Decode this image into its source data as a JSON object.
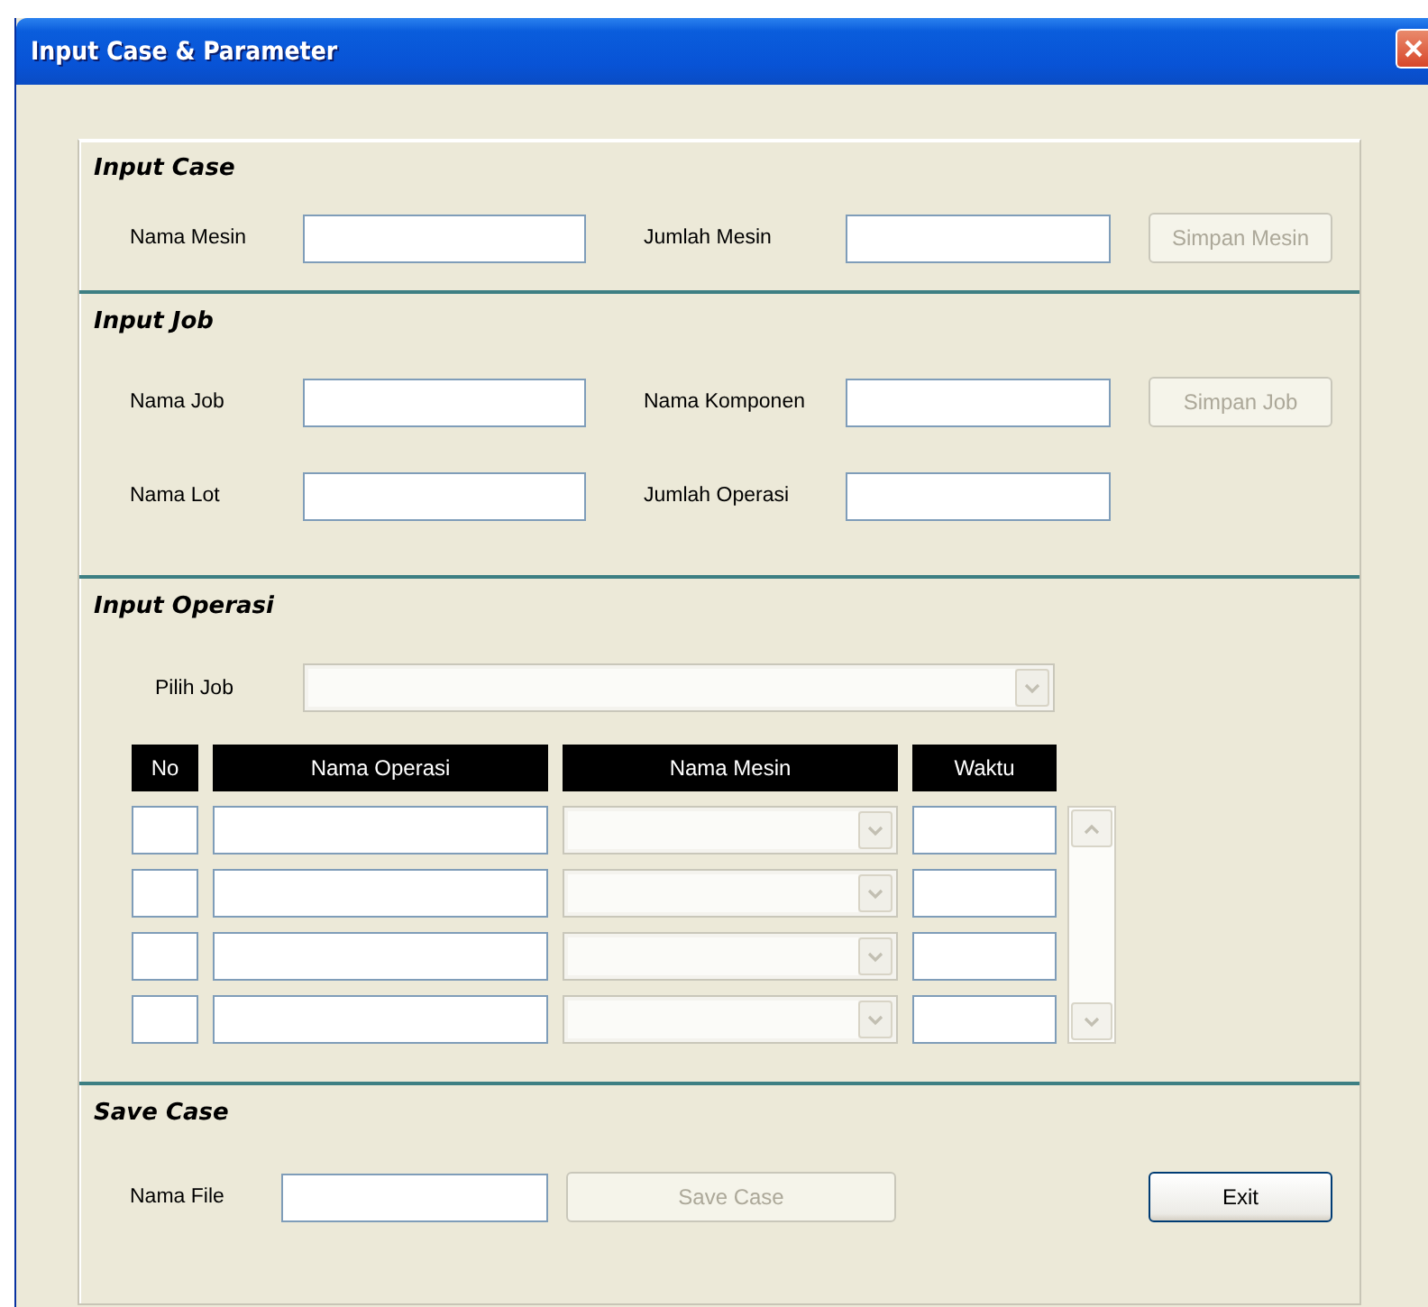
{
  "window": {
    "title": "Input Case & Parameter"
  },
  "sections": [
    {
      "kind": "form",
      "title": "Input Case",
      "rows": [
        {
          "items": [
            {
              "kind": "label",
              "text": "Nama Mesin"
            },
            {
              "kind": "field"
            },
            {
              "kind": "label",
              "text": "Jumlah Mesin"
            },
            {
              "kind": "field"
            },
            {
              "kind": "button",
              "label": "Simpan Mesin",
              "disabled": true
            }
          ]
        }
      ]
    },
    {
      "kind": "form",
      "title": "Input Job",
      "rows": [
        {
          "items": [
            {
              "kind": "label",
              "text": "Nama Job"
            },
            {
              "kind": "field"
            },
            {
              "kind": "label",
              "text": "Nama Komponen"
            },
            {
              "kind": "field"
            },
            {
              "kind": "button",
              "label": "Simpan Job",
              "disabled": true
            }
          ]
        },
        {
          "items": [
            {
              "kind": "label",
              "text": "Nama Lot"
            },
            {
              "kind": "field"
            },
            {
              "kind": "label",
              "text": "Jumlah Operasi"
            },
            {
              "kind": "field"
            }
          ]
        }
      ]
    },
    {
      "kind": "table",
      "title": "Input Operasi",
      "selector": {
        "label": "Pilih Job",
        "disabled": true
      },
      "columns": [
        "No",
        "Nama Operasi",
        "Nama Mesin",
        "Waktu"
      ],
      "rows": [
        {
          "cells": [
            {
              "kind": "field"
            },
            {
              "kind": "field"
            },
            {
              "kind": "combo",
              "disabled": true
            },
            {
              "kind": "field"
            }
          ]
        },
        {
          "cells": [
            {
              "kind": "field"
            },
            {
              "kind": "field"
            },
            {
              "kind": "combo",
              "disabled": true
            },
            {
              "kind": "field"
            }
          ]
        },
        {
          "cells": [
            {
              "kind": "field"
            },
            {
              "kind": "field"
            },
            {
              "kind": "combo",
              "disabled": true
            },
            {
              "kind": "field"
            }
          ]
        },
        {
          "cells": [
            {
              "kind": "field"
            },
            {
              "kind": "field"
            },
            {
              "kind": "combo",
              "disabled": true
            },
            {
              "kind": "field"
            }
          ]
        }
      ]
    },
    {
      "kind": "save",
      "title": "Save Case",
      "rows": [
        {
          "items": [
            {
              "kind": "label",
              "text": "Nama File"
            },
            {
              "kind": "field"
            },
            {
              "kind": "button",
              "label": "Save Case",
              "disabled": true
            },
            {
              "kind": "button",
              "label": "Exit",
              "disabled": false
            }
          ]
        }
      ]
    }
  ]
}
